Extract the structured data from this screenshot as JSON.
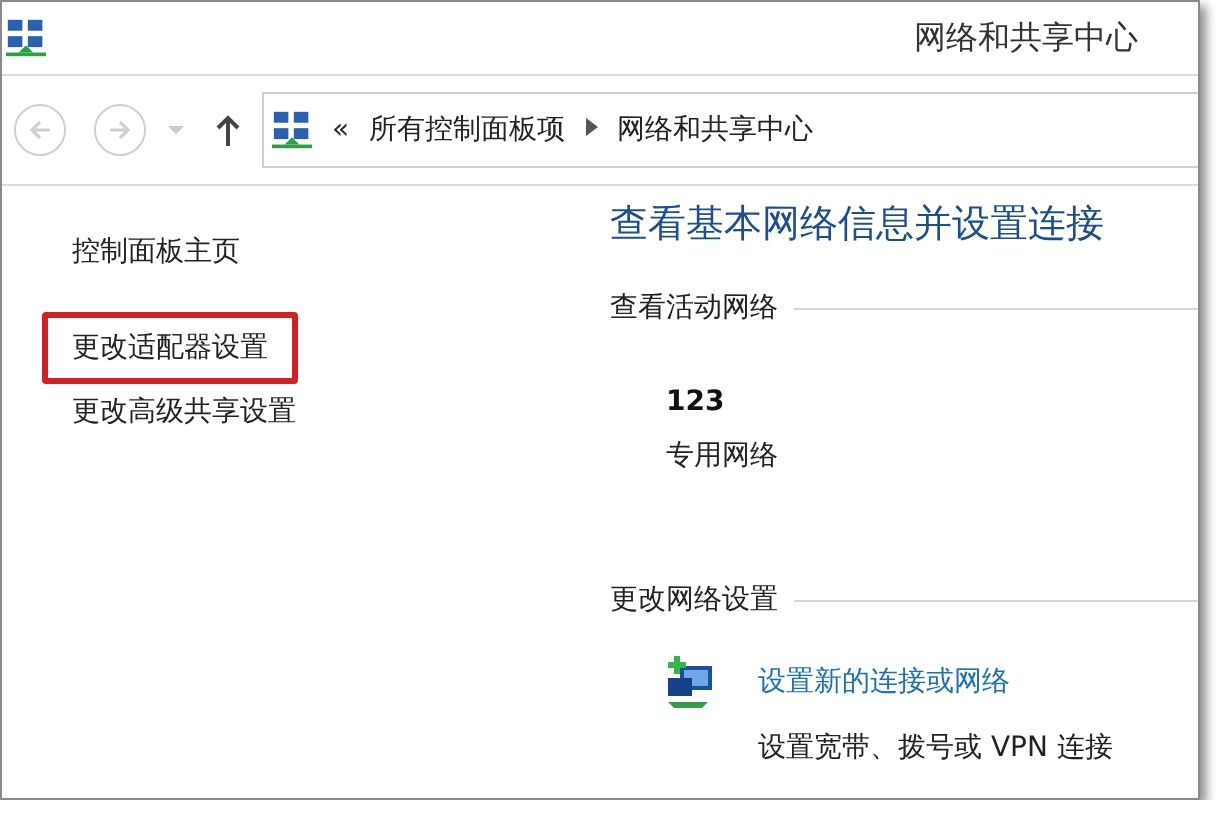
{
  "window": {
    "title": "网络和共享中心"
  },
  "navigation": {
    "back_disabled": true,
    "forward_disabled": true,
    "breadcrumb": {
      "overflow": "«",
      "items": [
        {
          "label": "所有控制面板项"
        },
        {
          "label": "网络和共享中心"
        }
      ]
    }
  },
  "sidebar": {
    "items": [
      {
        "label": "控制面板主页",
        "highlighted": false
      },
      {
        "label": "更改适配器设置",
        "highlighted": true
      },
      {
        "label": "更改高级共享设置",
        "highlighted": false
      }
    ]
  },
  "main": {
    "heading": "查看基本网络信息并设置连接",
    "active_networks": {
      "title": "查看活动网络",
      "networks": [
        {
          "name": "123",
          "category": "专用网络"
        }
      ]
    },
    "change_settings": {
      "title": "更改网络设置",
      "tasks": [
        {
          "link": "设置新的连接或网络",
          "description": "设置宽带、拨号或 VPN 连接"
        }
      ]
    }
  }
}
